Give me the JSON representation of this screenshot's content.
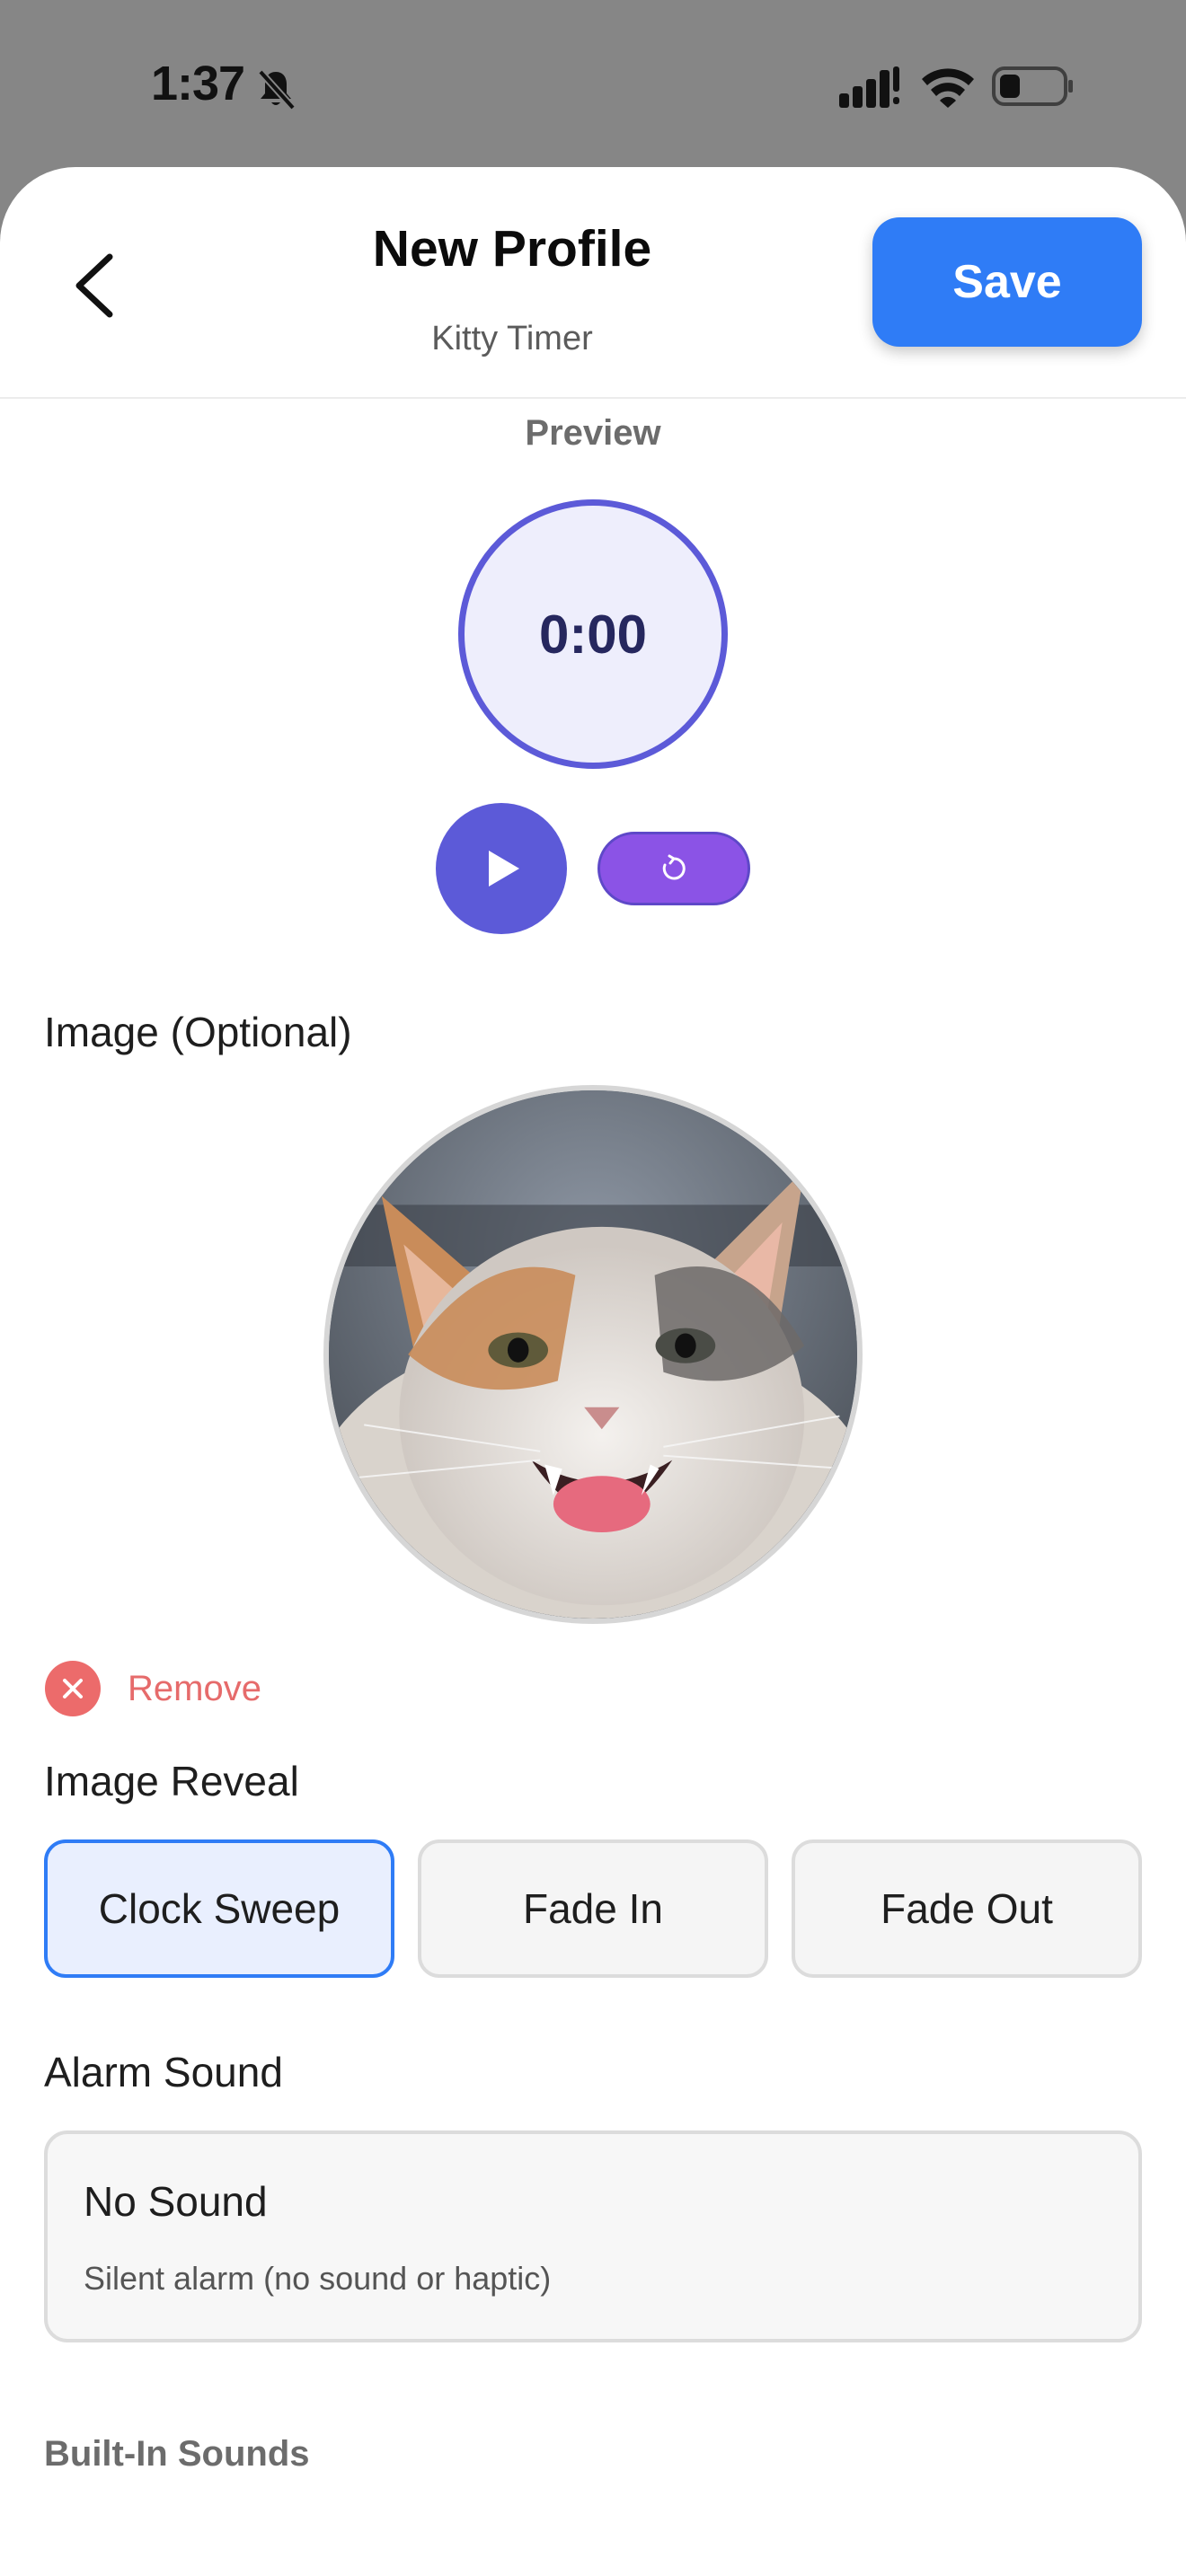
{
  "status_bar": {
    "time": "1:37"
  },
  "header": {
    "title": "New Profile",
    "subtitle": "Kitty Timer",
    "save_label": "Save"
  },
  "preview": {
    "label": "Preview",
    "timer_value": "0:00"
  },
  "image": {
    "label": "Image (Optional)",
    "remove_label": "Remove"
  },
  "image_reveal": {
    "label": "Image Reveal",
    "options": [
      "Clock Sweep",
      "Fade In",
      "Fade Out"
    ],
    "selected": "Clock Sweep"
  },
  "alarm_sound": {
    "label": "Alarm Sound",
    "selected_name": "No Sound",
    "selected_description": "Silent alarm (no sound or haptic)",
    "built_in_label": "Built-In Sounds"
  },
  "colors": {
    "accent_blue": "#2f7cf6",
    "timer_purple": "#5c5ad8",
    "reset_purple": "#8b53e6",
    "remove_red": "#ec6b6b"
  },
  "icons": [
    "bell-slash-icon",
    "signal-icon",
    "wifi-icon",
    "battery-icon",
    "chevron-left-icon",
    "play-icon",
    "reset-icon",
    "close-icon"
  ]
}
